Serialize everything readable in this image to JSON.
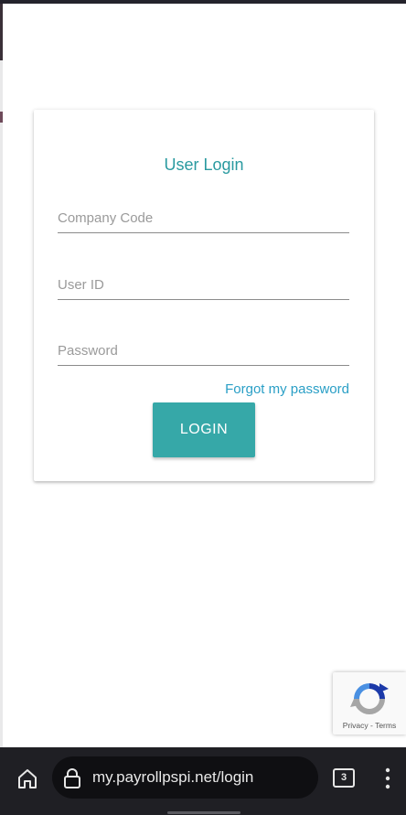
{
  "login": {
    "title": "User Login",
    "company_code_placeholder": "Company Code",
    "user_id_placeholder": "User ID",
    "password_placeholder": "Password",
    "forgot_label": "Forgot my password",
    "login_label": "LOGIN"
  },
  "recaptcha": {
    "links": "Privacy - Terms"
  },
  "browser": {
    "url": "my.payrollpspi.net/login",
    "tab_count": "3"
  },
  "colors": {
    "accent": "#36a8a8",
    "title": "#2a9aa0",
    "link": "#2a9fc6",
    "bar": "#1f1f24"
  }
}
